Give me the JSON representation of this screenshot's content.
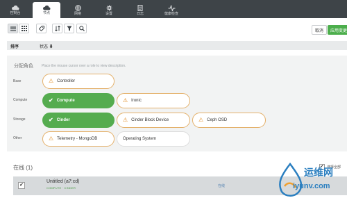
{
  "nav": {
    "tabs": [
      {
        "label": "控制台",
        "icon": "cloud-icon"
      },
      {
        "label": "节点",
        "icon": "cloud-icon"
      },
      {
        "label": "网络",
        "icon": "globe-icon"
      },
      {
        "label": "设置",
        "icon": "gear-icon"
      },
      {
        "label": "日志",
        "icon": "log-icon"
      },
      {
        "label": "健康检查",
        "icon": "health-icon"
      }
    ],
    "active_tab": 1
  },
  "toolbar": {
    "cancel_label": "取消",
    "apply_label": "应用变更"
  },
  "sortbar": {
    "sort_label": "排序",
    "status_label": "状态 ⬇"
  },
  "roles": {
    "title": "分配角色",
    "hint": "Place the mouse cursor over a role to view description.",
    "groups": [
      {
        "label": "Base"
      },
      {
        "label": "Compute"
      },
      {
        "label": "Storage"
      },
      {
        "label": "Other"
      }
    ],
    "items": {
      "controller": {
        "label": "Controller",
        "selected": false
      },
      "compute": {
        "label": "Compute",
        "selected": true
      },
      "ironic": {
        "label": "Ironic",
        "selected": false
      },
      "cinder": {
        "label": "Cinder",
        "selected": true
      },
      "cinder_block_device": {
        "label": "Cinder Block Device",
        "selected": false
      },
      "ceph_osd": {
        "label": "Ceph OSD",
        "selected": false
      },
      "telemetry": {
        "label": "Telemetry - MongoDB",
        "selected": false
      },
      "os": {
        "label": "Operating System",
        "selected": false
      }
    }
  },
  "online": {
    "title": "在线 (1)",
    "select_all": "选择全部"
  },
  "nodes": [
    {
      "name": "Untitled (a7:cd)",
      "roles": "COMPUTE · CINDER",
      "status": "在线",
      "checked": true
    }
  ],
  "watermark": {
    "line1": "运维网",
    "line2": "iyunv.com"
  },
  "colors": {
    "nav_bg": "#3e4448",
    "selected_green": "#55ac4f",
    "apply_green": "#4cae4c",
    "role_border": "#e4b06a",
    "warning_orange": "#e08a1e",
    "watermark_blue": "#2b7fc0"
  }
}
